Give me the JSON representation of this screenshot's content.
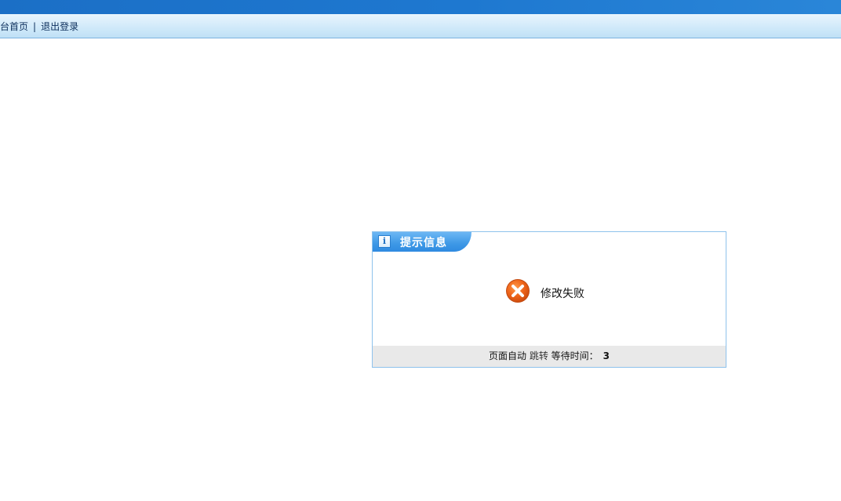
{
  "nav": {
    "home_link": "后台首页",
    "separator": "|",
    "logout_link": "退出登录"
  },
  "dialog": {
    "title": "提示信息",
    "info_icon": "info-icon",
    "status_icon": "error-x-icon",
    "message": "修改失败",
    "footer_prefix": "页面自动",
    "footer_jump": "跳转",
    "footer_wait": "等待时间：",
    "countdown": "3"
  },
  "colors": {
    "top_strip": "#1e78d0",
    "navbar": "#d3ebfa",
    "dialog_tab": "#3d98e6",
    "dialog_border": "#8ec2ec",
    "footer_bg": "#e9e9e9",
    "error_icon": "#ea5a1a"
  }
}
